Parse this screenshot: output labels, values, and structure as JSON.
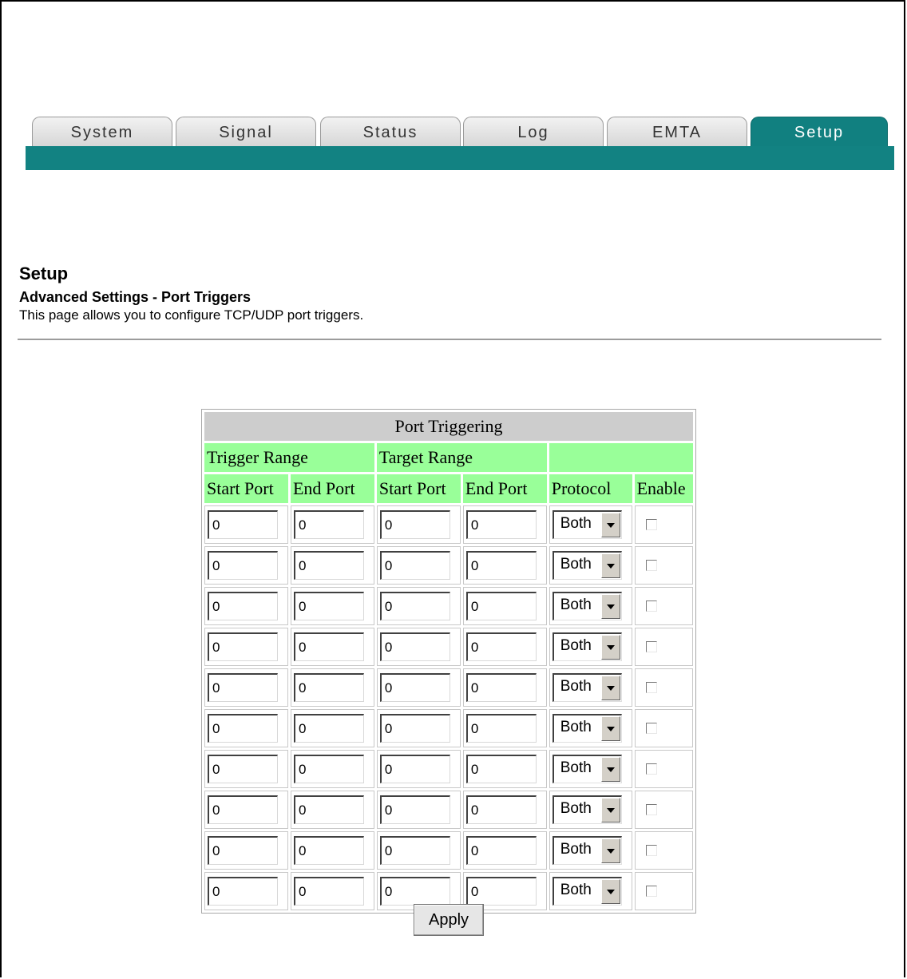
{
  "tabs": [
    {
      "label": "System",
      "active": false
    },
    {
      "label": "Signal",
      "active": false
    },
    {
      "label": "Status",
      "active": false
    },
    {
      "label": "Log",
      "active": false
    },
    {
      "label": "EMTA",
      "active": false
    },
    {
      "label": "Setup",
      "active": true
    }
  ],
  "colors": {
    "accent": "#128282",
    "header_cell": "#99ff99",
    "caption_cell": "#cdcdcd"
  },
  "page": {
    "title": "Setup",
    "subtitle": "Advanced Settings - Port Triggers",
    "description": "This page allows you to configure TCP/UDP port triggers."
  },
  "table": {
    "caption": "Port Triggering",
    "group_headers": [
      "Trigger Range",
      "Target Range",
      ""
    ],
    "columns": [
      "Start Port",
      "End Port",
      "Start Port",
      "End Port",
      "Protocol",
      "Enable"
    ],
    "rows": [
      {
        "trigger_start": "0",
        "trigger_end": "0",
        "target_start": "0",
        "target_end": "0",
        "protocol": "Both",
        "enabled": false
      },
      {
        "trigger_start": "0",
        "trigger_end": "0",
        "target_start": "0",
        "target_end": "0",
        "protocol": "Both",
        "enabled": false
      },
      {
        "trigger_start": "0",
        "trigger_end": "0",
        "target_start": "0",
        "target_end": "0",
        "protocol": "Both",
        "enabled": false
      },
      {
        "trigger_start": "0",
        "trigger_end": "0",
        "target_start": "0",
        "target_end": "0",
        "protocol": "Both",
        "enabled": false
      },
      {
        "trigger_start": "0",
        "trigger_end": "0",
        "target_start": "0",
        "target_end": "0",
        "protocol": "Both",
        "enabled": false
      },
      {
        "trigger_start": "0",
        "trigger_end": "0",
        "target_start": "0",
        "target_end": "0",
        "protocol": "Both",
        "enabled": false
      },
      {
        "trigger_start": "0",
        "trigger_end": "0",
        "target_start": "0",
        "target_end": "0",
        "protocol": "Both",
        "enabled": false
      },
      {
        "trigger_start": "0",
        "trigger_end": "0",
        "target_start": "0",
        "target_end": "0",
        "protocol": "Both",
        "enabled": false
      },
      {
        "trigger_start": "0",
        "trigger_end": "0",
        "target_start": "0",
        "target_end": "0",
        "protocol": "Both",
        "enabled": false
      },
      {
        "trigger_start": "0",
        "trigger_end": "0",
        "target_start": "0",
        "target_end": "0",
        "protocol": "Both",
        "enabled": false
      }
    ]
  },
  "apply_label": "Apply",
  "icons": {
    "dropdown": "chevron-down-icon",
    "checkbox": "checkbox-icon"
  }
}
